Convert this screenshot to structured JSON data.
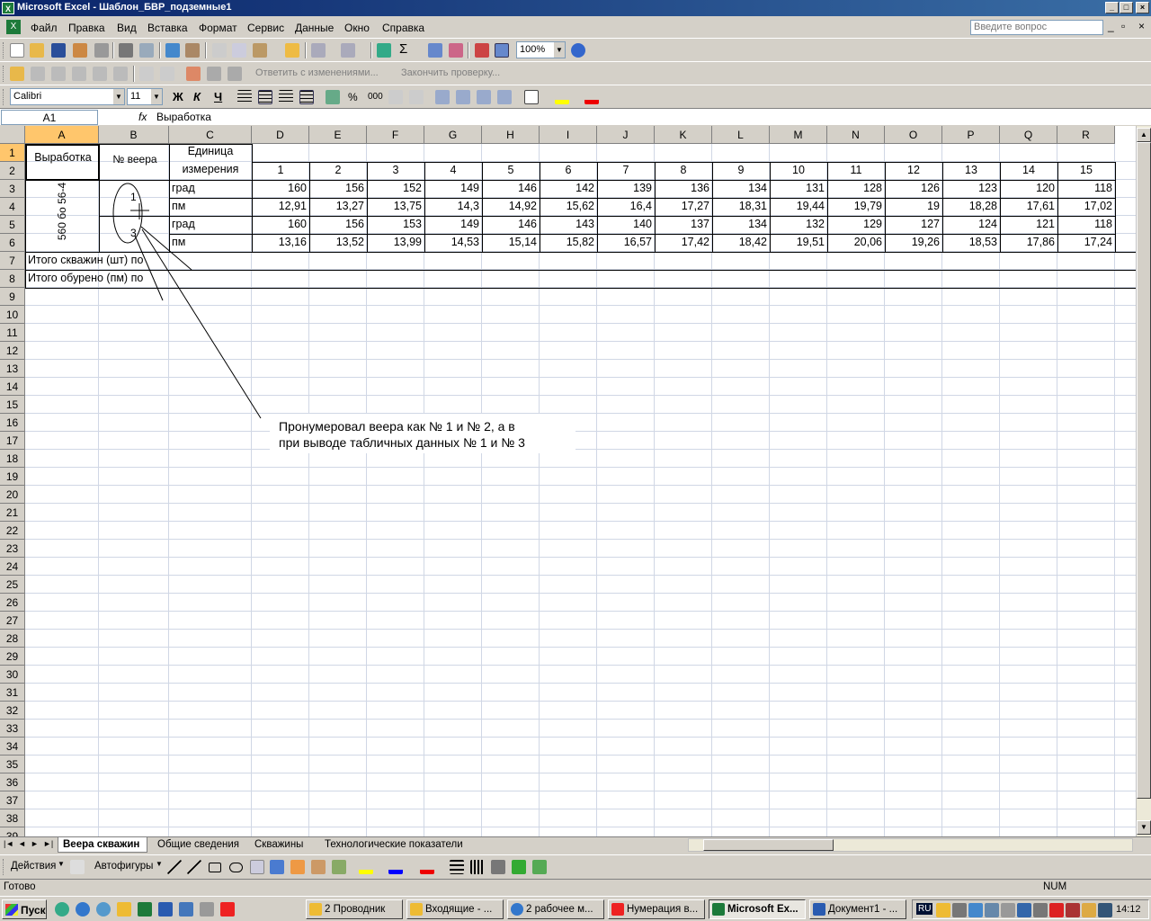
{
  "window": {
    "title": "Microsoft Excel - Шаблон_БВР_подземные1"
  },
  "menu": [
    "Файл",
    "Правка",
    "Вид",
    "Вставка",
    "Формат",
    "Сервис",
    "Данные",
    "Окно",
    "Справка"
  ],
  "ask_placeholder": "Введите вопрос",
  "toolbar": {
    "zoom": "100%",
    "sigma": "Σ"
  },
  "review_toolbar": {
    "reply_label": "Ответить с изменениями...",
    "end_review_label": "Закончить проверку..."
  },
  "format_toolbar": {
    "font": "Calibri",
    "size": "11",
    "bold": "Ж",
    "italic": "К",
    "underline": "Ч",
    "percent": "%",
    "thousands": "000"
  },
  "formula_bar": {
    "name_box": "A1",
    "fx": "fx",
    "value": "Выработка"
  },
  "columns": [
    "A",
    "B",
    "C",
    "D",
    "E",
    "F",
    "G",
    "H",
    "I",
    "J",
    "K",
    "L",
    "M",
    "N",
    "O",
    "P",
    "Q",
    "R"
  ],
  "sheet": {
    "a1": "Выработка",
    "b1": "№ веера",
    "c1": "Единица",
    "c2": "измерения",
    "vertical_label": "560 бо 56-4",
    "fan_top": "1",
    "fan_bottom": "3",
    "hole_numbers": [
      "1",
      "2",
      "3",
      "4",
      "5",
      "6",
      "7",
      "8",
      "9",
      "10",
      "11",
      "12",
      "13",
      "14",
      "15"
    ],
    "rows": [
      {
        "unit": "град",
        "values": [
          "160",
          "156",
          "152",
          "149",
          "146",
          "142",
          "139",
          "136",
          "134",
          "131",
          "128",
          "126",
          "123",
          "120",
          "118"
        ]
      },
      {
        "unit": "пм",
        "values": [
          "12,91",
          "13,27",
          "13,75",
          "14,3",
          "14,92",
          "15,62",
          "16,4",
          "17,27",
          "18,31",
          "19,44",
          "19,79",
          "19",
          "18,28",
          "17,61",
          "17,02"
        ]
      },
      {
        "unit": "град",
        "values": [
          "160",
          "156",
          "153",
          "149",
          "146",
          "143",
          "140",
          "137",
          "134",
          "132",
          "129",
          "127",
          "124",
          "121",
          "118"
        ]
      },
      {
        "unit": "пм",
        "values": [
          "13,16",
          "13,52",
          "13,99",
          "14,53",
          "15,14",
          "15,82",
          "16,57",
          "17,42",
          "18,42",
          "19,51",
          "20,06",
          "19,26",
          "18,53",
          "17,86",
          "17,24"
        ]
      }
    ],
    "row7": "Итого скважин (шт) по",
    "row8": "Итого обурено (пм) по",
    "comment_line1": "Пронумеровал веера как № 1 и № 2, а в",
    "comment_line2": "при выводе табличных данных № 1 и № 3"
  },
  "sheet_tabs": [
    "Веера скважин",
    "Общие сведения",
    "Скважины",
    "Технологические показатели"
  ],
  "draw_toolbar": {
    "actions": "Действия",
    "autoshapes": "Автофигуры"
  },
  "status": {
    "left": "Готово",
    "num": "NUM"
  },
  "taskbar": {
    "start": "Пуск",
    "items": [
      "2 Проводник",
      "Входящие - ...",
      "2 рабочее м...",
      "Нумерация в...",
      "Microsoft Ex...",
      "Документ1 - ..."
    ],
    "lang": "RU",
    "clock": "14:12"
  }
}
